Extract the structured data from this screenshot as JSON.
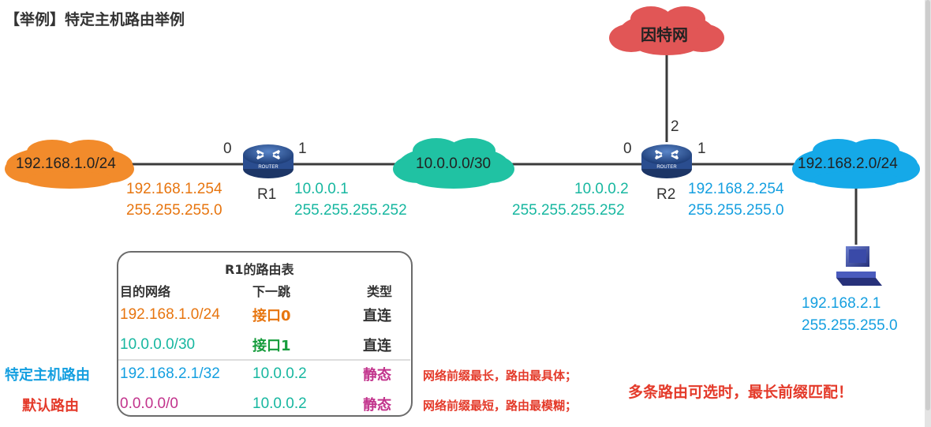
{
  "title": "【举例】特定主机路由举例",
  "clouds": {
    "internet": "因特网",
    "left_net": "192.168.1.0/24",
    "mid_net": "10.0.0.0/30",
    "right_net": "192.168.2.0/24"
  },
  "routers": {
    "r1": {
      "name": "R1",
      "port_left": "0",
      "port_right": "1",
      "icon_text": "ROUTER"
    },
    "r2": {
      "name": "R2",
      "port_left": "0",
      "port_right": "1",
      "port_top": "2",
      "icon_text": "ROUTER"
    }
  },
  "interfaces": {
    "r1_if0_ip": "192.168.1.254",
    "r1_if0_mask": "255.255.255.0",
    "r1_if1_ip": "10.0.0.1",
    "r1_if1_mask": "255.255.255.252",
    "r2_if0_ip": "10.0.0.2",
    "r2_if0_mask": "255.255.255.252",
    "r2_if1_ip": "192.168.2.254",
    "r2_if1_mask": "255.255.255.0"
  },
  "host": {
    "ip": "192.168.2.1",
    "mask": "255.255.255.0"
  },
  "routing_table": {
    "title": "R1的路由表",
    "headers": [
      "目的网络",
      "下一跳",
      "类型"
    ],
    "rows": [
      {
        "dest": "192.168.1.0/24",
        "next": "接口0",
        "type": "直连"
      },
      {
        "dest": "10.0.0.0/30",
        "next": "接口1",
        "type": "直连"
      },
      {
        "dest": "192.168.2.1/32",
        "next": "10.0.0.2",
        "type": "静态"
      },
      {
        "dest": "0.0.0.0/0",
        "next": "10.0.0.2",
        "type": "静态"
      }
    ]
  },
  "side_labels": {
    "host_route": "特定主机路由",
    "default_route": "默认路由"
  },
  "notes": {
    "longest": "网络前缀最长，路由最具体；",
    "shortest": "网络前缀最短，路由最模糊；",
    "rule": "多条路由可选时，最长前缀匹配！"
  }
}
